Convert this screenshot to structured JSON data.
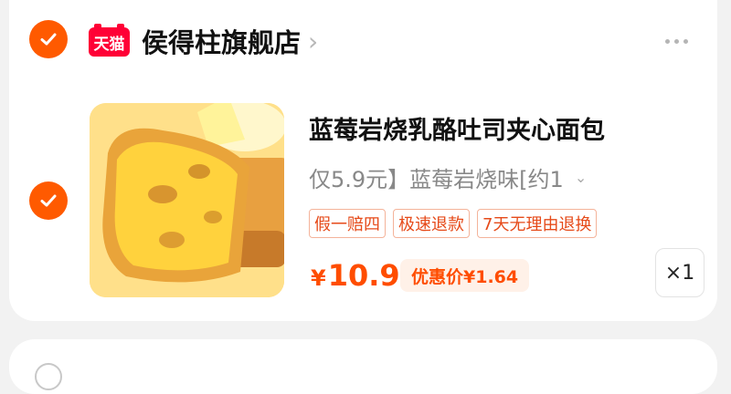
{
  "store": {
    "badge": "天猫",
    "name": "侯得柱旗舰店",
    "chevron": "›"
  },
  "product": {
    "title": "蓝莓岩烧乳酪吐司夹心面包",
    "sku_text": "仅5.9元】蓝莓岩烧味[约1",
    "sku_chevron": "⌄",
    "tags": [
      "假一赔四",
      "极速退款",
      "7天无理由退换"
    ],
    "price_symbol": "¥",
    "price_value": "10.9",
    "discount_label": "优惠价¥1.64",
    "quantity": "×1",
    "image_icon": "toast-bread-image"
  },
  "colors": {
    "accent": "#ff5a00",
    "tmall_red": "#ff0036",
    "price": "#ff4d00",
    "tag_border": "#f4b39a"
  }
}
